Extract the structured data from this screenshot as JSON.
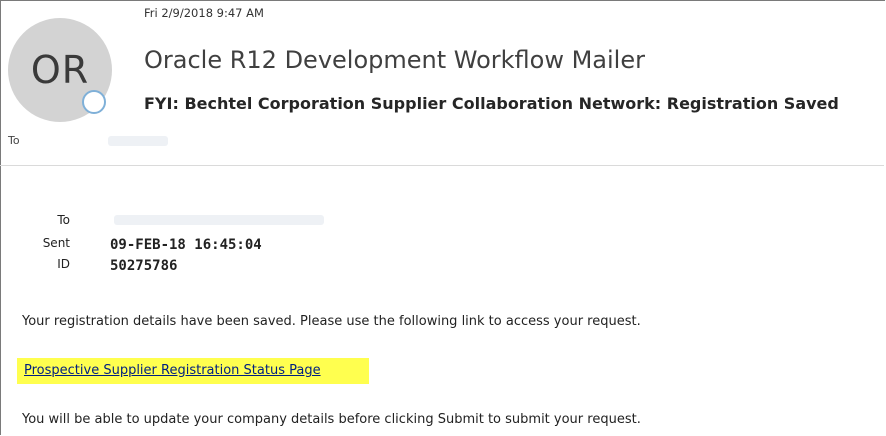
{
  "email": {
    "received_time": "Fri 2/9/2018 9:47 AM",
    "sender_initials": "OR",
    "sender_name": "Oracle R12 Development Workflow Mailer",
    "subject": "FYI: Bechtel Corporation Supplier Collaboration Network:  Registration Saved",
    "to_label": "To"
  },
  "details": {
    "to_label": "To",
    "sent_label": "Sent",
    "sent_value": "09-FEB-18 16:45:04",
    "id_label": "ID",
    "id_value": "50275786"
  },
  "message": {
    "intro": "Your registration details have been saved. Please use the following link to access your request.",
    "link_text": "Prospective Supplier Registration Status Page",
    "outro": "You will be able to update your company details before clicking Submit to submit your request."
  },
  "colors": {
    "link_highlight": "#ffff4f",
    "link_text": "#001f80",
    "avatar_bg": "#d3d3d3",
    "presence_ring": "#7fb0d8"
  }
}
